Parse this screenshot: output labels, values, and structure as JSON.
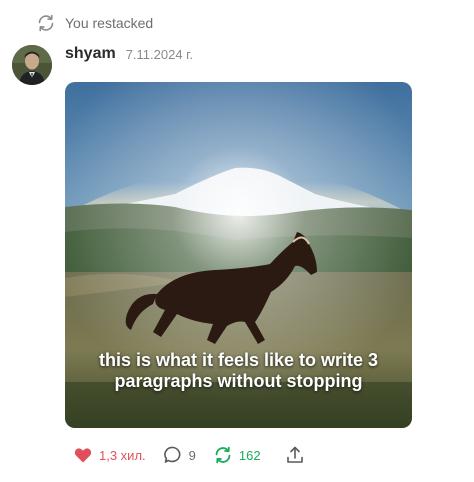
{
  "restack_banner": {
    "label": "You restacked",
    "icon": "restack-icon"
  },
  "post": {
    "author": "shyam",
    "date": "7.11.2024 г.",
    "media_caption": "this is what it feels like to write 3 paragraphs without stopping"
  },
  "actions": {
    "like_count": "1,3 хил.",
    "comment_count": "9",
    "restack_count": "162"
  },
  "colors": {
    "like": "#e0505c",
    "restack": "#1bab5a",
    "muted": "#6e6e6e"
  }
}
